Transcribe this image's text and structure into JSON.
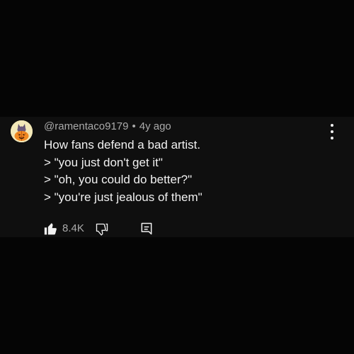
{
  "comment": {
    "author": "@ramentaco9179",
    "separator": "•",
    "time": "4y ago",
    "lines": [
      "How fans defend a bad artist.",
      "> \"you just don't get it\"",
      "> \"oh, you could do better?\"",
      "> \"you're just jealous of them\""
    ],
    "like_count": "8.4K"
  },
  "icons": {
    "avatar": "pumpkin-cat-avatar",
    "more": "more-vertical-icon",
    "like": "thumb-up-filled-icon",
    "dislike": "thumb-down-outline-icon",
    "reply": "reply-comment-icon"
  },
  "colors": {
    "background": "#050505",
    "comment_background": "#0f0f0f",
    "text_primary": "#f1f1f1",
    "text_secondary": "#aaaaaa"
  }
}
